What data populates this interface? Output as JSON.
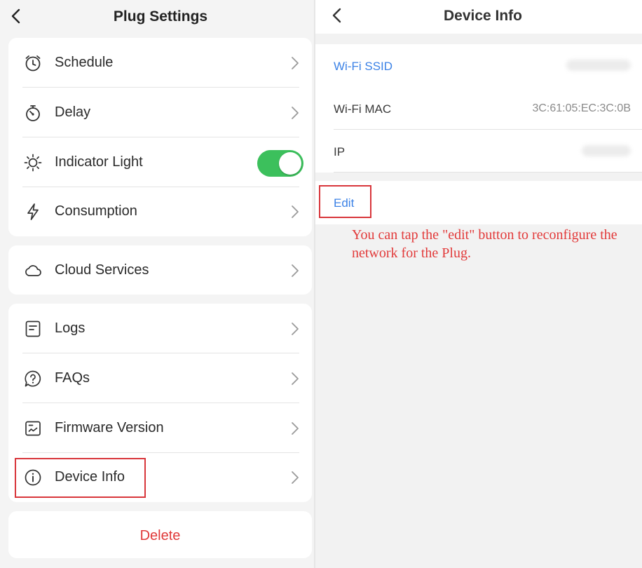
{
  "left": {
    "title": "Plug Settings",
    "back_icon": "chevron-left-icon",
    "groups": [
      {
        "items": [
          {
            "label": "Schedule",
            "icon": "clock-icon",
            "control": "chevron"
          },
          {
            "label": "Delay",
            "icon": "timer-icon",
            "control": "chevron"
          },
          {
            "label": "Indicator Light",
            "icon": "sun-icon",
            "control": "toggle",
            "toggle_on": true
          },
          {
            "label": "Consumption",
            "icon": "lightning-icon",
            "control": "chevron"
          }
        ]
      },
      {
        "items": [
          {
            "label": "Cloud Services",
            "icon": "cloud-icon",
            "control": "chevron"
          }
        ]
      },
      {
        "items": [
          {
            "label": "Logs",
            "icon": "document-icon",
            "control": "chevron"
          },
          {
            "label": "FAQs",
            "icon": "question-bubble-icon",
            "control": "chevron"
          },
          {
            "label": "Firmware Version",
            "icon": "firmware-icon",
            "control": "chevron"
          },
          {
            "label": "Device Info",
            "icon": "info-icon",
            "control": "chevron",
            "highlighted": true
          }
        ]
      }
    ],
    "delete_label": "Delete"
  },
  "right": {
    "title": "Device Info",
    "back_icon": "chevron-left-icon",
    "rows": [
      {
        "label": "Wi-Fi SSID",
        "value": "",
        "value_hidden": true,
        "label_color": "#3c82e6"
      },
      {
        "label": "Wi-Fi MAC",
        "value": "3C:61:05:EC:3C:0B",
        "value_hidden": false
      },
      {
        "label": "IP",
        "value": "",
        "value_hidden": true
      }
    ],
    "edit_label": "Edit",
    "annotation": "You can tap the \"edit\" button to reconfigure the network for the Plug."
  },
  "colors": {
    "accent_blue": "#3c82e6",
    "toggle_green": "#3cc05c",
    "danger_red": "#e03a3a",
    "highlight_box": "#d8363b"
  }
}
